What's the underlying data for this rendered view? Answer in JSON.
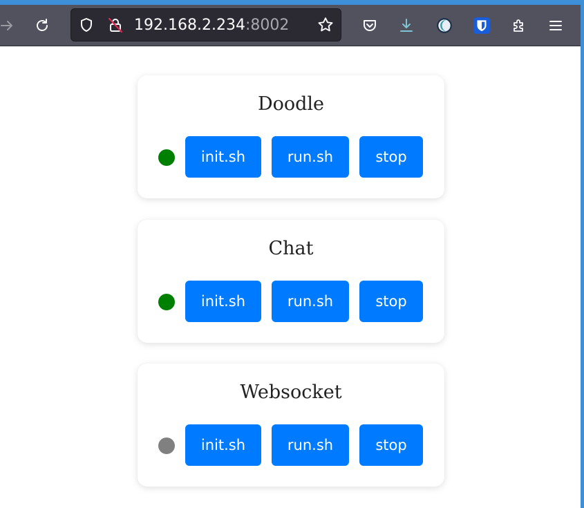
{
  "browser": {
    "url_host": "192.168.2.234",
    "url_port": ":8002",
    "icons": [
      "forward-icon",
      "reload-icon",
      "tracking-shield-icon",
      "insecure-lock-icon",
      "bookmark-star-icon",
      "pocket-icon",
      "downloads-icon",
      "extension-moon-icon",
      "bitwarden-icon",
      "extensions-icon",
      "menu-icon"
    ]
  },
  "colors": {
    "button": "#007bff",
    "status_running": "#008000",
    "status_stopped": "#808080",
    "accent": "#3d8fd8"
  },
  "services": [
    {
      "name": "Doodle",
      "status": "running",
      "buttons": {
        "init": "init.sh",
        "run": "run.sh",
        "stop": "stop"
      }
    },
    {
      "name": "Chat",
      "status": "running",
      "buttons": {
        "init": "init.sh",
        "run": "run.sh",
        "stop": "stop"
      }
    },
    {
      "name": "Websocket",
      "status": "stopped",
      "buttons": {
        "init": "init.sh",
        "run": "run.sh",
        "stop": "stop"
      }
    }
  ]
}
